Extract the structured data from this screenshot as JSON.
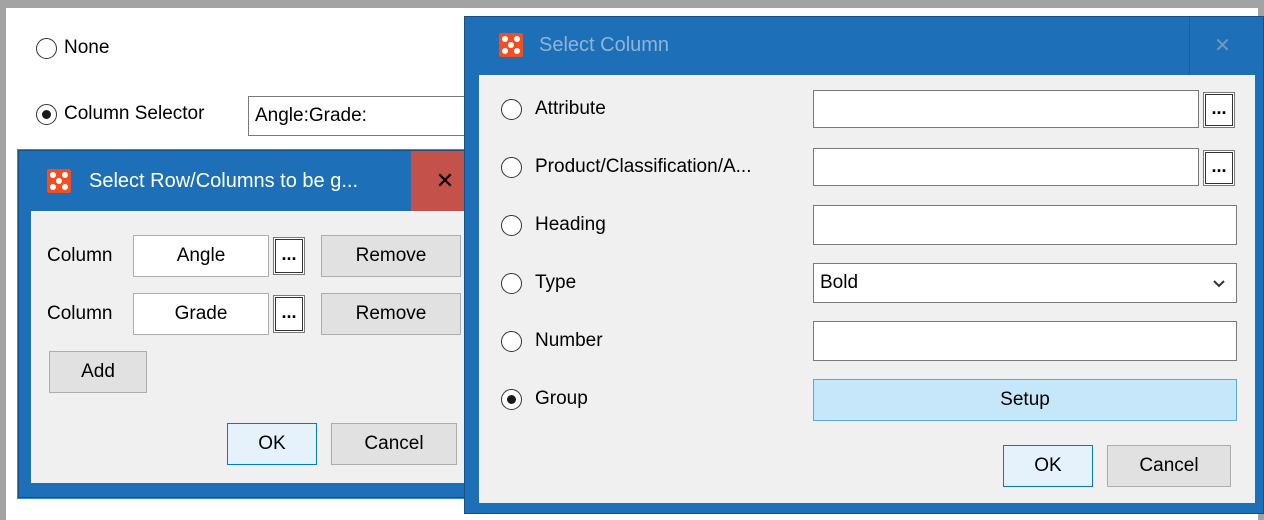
{
  "background": {
    "radio_none_label": "None",
    "radio_column_selector_label": "Column Selector",
    "column_selector_value": "Angle:Grade:"
  },
  "dialog_rows": {
    "title": "Select Row/Columns to be g...",
    "close_glyph": "✕",
    "rows": [
      {
        "label": "Column",
        "value": "Angle",
        "browse": "...",
        "remove": "Remove"
      },
      {
        "label": "Column",
        "value": "Grade",
        "browse": "...",
        "remove": "Remove"
      }
    ],
    "add_label": "Add",
    "ok_label": "OK",
    "cancel_label": "Cancel"
  },
  "dialog_column": {
    "title": "Select Column",
    "close_glyph": "✕",
    "options": {
      "attribute": "Attribute",
      "product": "Product/Classification/A...",
      "heading": "Heading",
      "type": "Type",
      "number": "Number",
      "group": "Group"
    },
    "browse": "...",
    "type_value": "Bold",
    "setup_label": "Setup",
    "ok_label": "OK",
    "cancel_label": "Cancel",
    "selected_option": "group"
  },
  "colors": {
    "title_blue": "#1d70b8",
    "close_red": "#c4524a",
    "brand_orange": "#f04e23",
    "setup_fill": "#c6e6f9"
  }
}
